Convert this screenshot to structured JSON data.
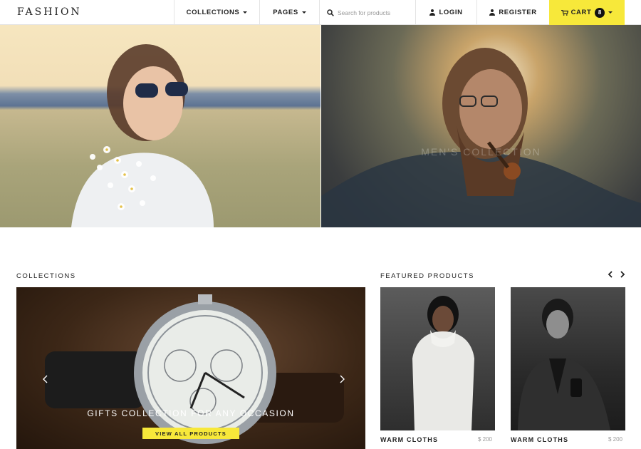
{
  "brand": {
    "logo": "FASHION"
  },
  "nav": {
    "collections": "COLLECTIONS",
    "pages": "PAGES",
    "search_placeholder": "Search for products",
    "login": "LOGIN",
    "register": "REGISTER",
    "cart": "CART",
    "cart_count": "8"
  },
  "hero": {
    "right_caption": "MEN'S COLLECTION"
  },
  "collections": {
    "title": "COLLECTIONS",
    "slide_caption": "GIFTS COLLECTION FOR ANY OCCASION",
    "slide_button": "VIEW ALL PRODUCTS"
  },
  "featured": {
    "title": "FEATURED PRODUCTS",
    "products": [
      {
        "name": "WARM CLOTHS",
        "price": "$ 200"
      },
      {
        "name": "WARM CLOTHS",
        "price": "$ 200"
      }
    ]
  },
  "colors": {
    "accent": "#f7e83a",
    "text": "#222222",
    "border": "#e4e4e4"
  }
}
